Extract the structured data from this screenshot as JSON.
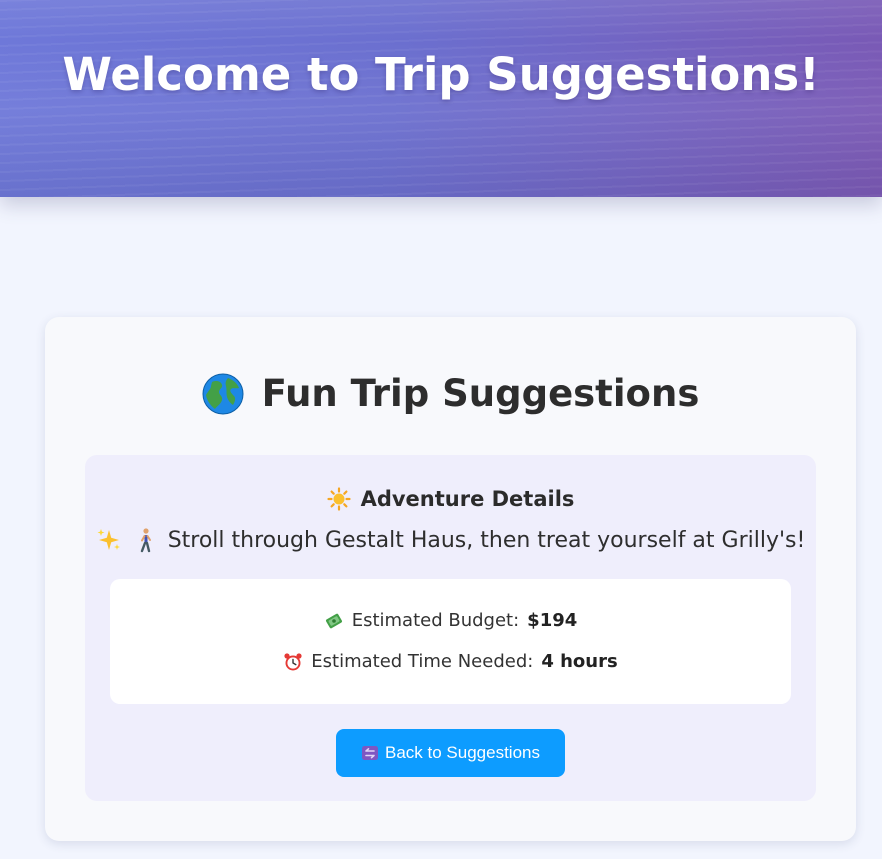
{
  "hero": {
    "title": "Welcome to Trip Suggestions!"
  },
  "card": {
    "title": "Fun Trip Suggestions",
    "title_icon": "globe-icon"
  },
  "details": {
    "heading": "Adventure Details",
    "heading_icon": "sun-icon",
    "description": "Stroll through Gestalt Haus, then treat yourself at Grilly's!",
    "description_icons": [
      "sparkles-icon",
      "person-walking-icon"
    ],
    "budget": {
      "icon": "money-with-wings-icon",
      "label": "Estimated Budget:",
      "value": "$194"
    },
    "time": {
      "icon": "alarm-clock-icon",
      "label": "Estimated Time Needed:",
      "value": "4 hours"
    }
  },
  "actions": {
    "back_icon": "back-arrows-icon",
    "back_label": "Back to Suggestions"
  },
  "colors": {
    "hero_start": "#6e78d9",
    "hero_end": "#7a58b4",
    "button": "#0d9cff",
    "detail_bg": "#efeefc",
    "page_bg": "#f2f5fe"
  }
}
